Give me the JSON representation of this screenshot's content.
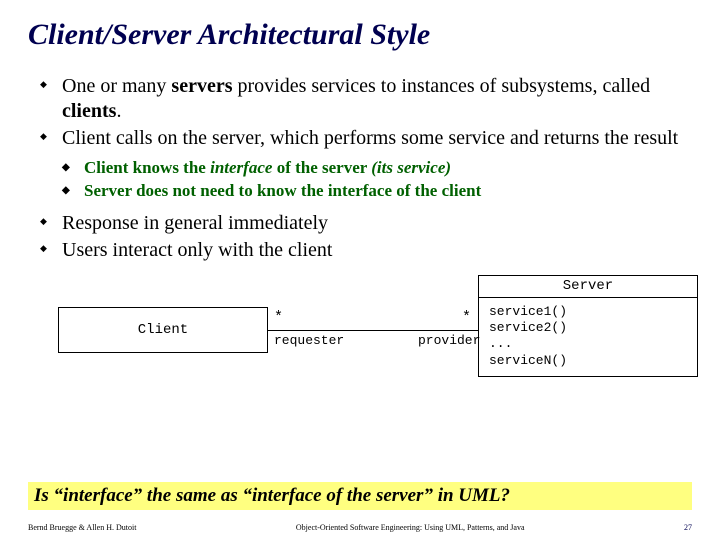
{
  "title": "Client/Server Architectural Style",
  "bullets": {
    "b1_pre": "One or many ",
    "b1_bold": "servers",
    "b1_mid": " provides services to instances of subsystems, called ",
    "b1_bold2": "clients",
    "b1_post": ".",
    "b2": "Client calls on the server, which performs some service and returns the result",
    "s1_pre": "Client knows the ",
    "s1_bi": "interface",
    "s1_mid": " of the server ",
    "s1_it": "(its service)",
    "s2": "Server does not need to know the interface of the client",
    "b3": "Response in general immediately",
    "b4": "Users interact only with the client"
  },
  "diagram": {
    "client": "Client",
    "server": "Server",
    "star": "*",
    "requester": "requester",
    "provider": "provider",
    "svc1": "service1()",
    "svc2": "service2()",
    "ellipsis": "...",
    "svcN": "serviceN()"
  },
  "question": "Is “interface” the same as “interface of the server” in UML?",
  "footer": {
    "left": "Bernd Bruegge & Allen H. Dutoit",
    "center": "Object-Oriented Software Engineering: Using UML, Patterns, and Java",
    "right": "27"
  }
}
